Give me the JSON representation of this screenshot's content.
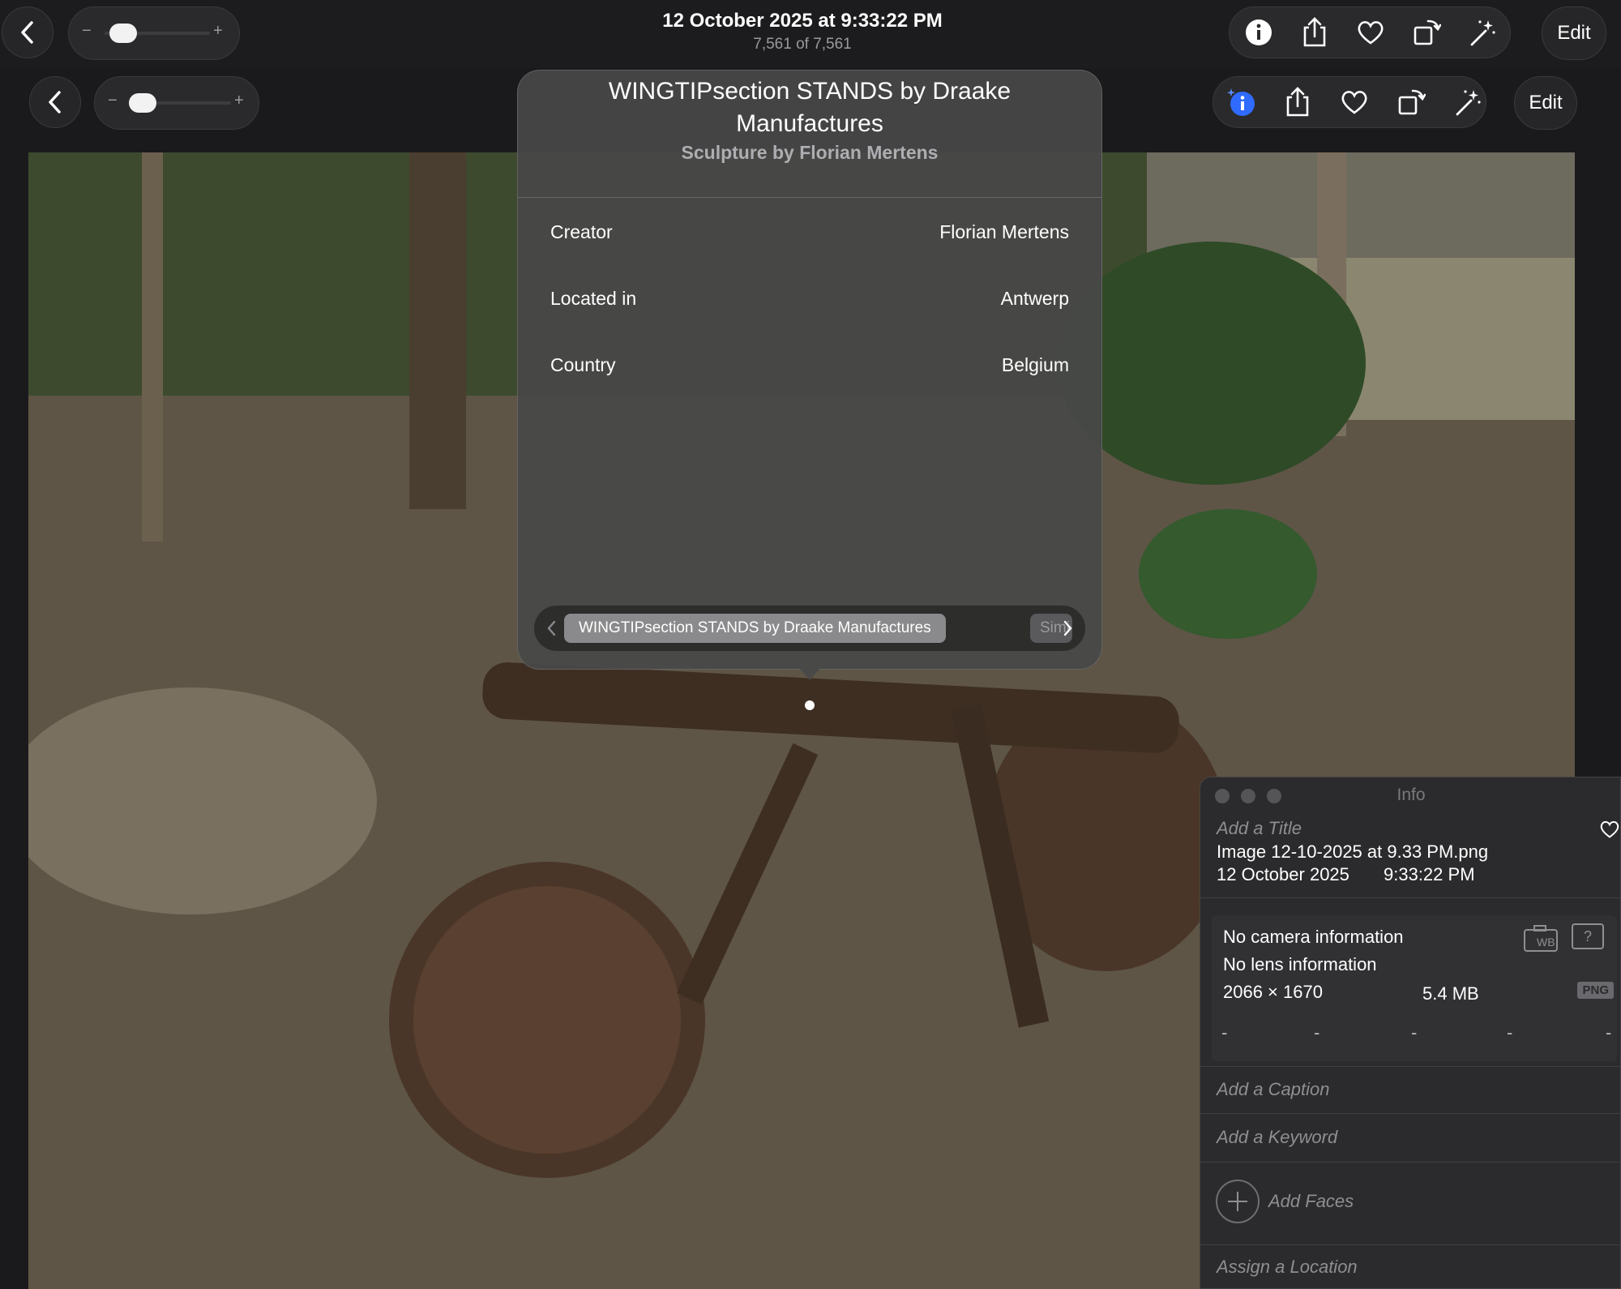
{
  "top_bar": {
    "date_title": "12 October 2025 at 9:33:22 PM",
    "counter": "7,561 of 7,561",
    "edit_label": "Edit",
    "slider_minus": "−",
    "slider_plus": "+",
    "zoom_level": 0.1
  },
  "second_bar": {
    "edit_label": "Edit",
    "slider_minus": "−",
    "slider_plus": "+",
    "zoom_level": 0.1
  },
  "popover": {
    "title": "WINGTIPsection STANDS by Draake Manufactures",
    "subtitle": "Sculpture by Florian Mertens",
    "rows": [
      {
        "label": "Creator",
        "value": "Florian Mertens"
      },
      {
        "label": "Located in",
        "value": "Antwerp"
      },
      {
        "label": "Country",
        "value": "Belgium"
      }
    ],
    "tabs": [
      {
        "label": "WINGTIPsection STANDS by Draake Manufactures",
        "active": true
      },
      {
        "label": "Simi",
        "active": false
      }
    ]
  },
  "info_panel": {
    "header": "Info",
    "title_placeholder": "Add a Title",
    "filename": "Image 12-10-2025 at 9.33 PM.png",
    "date": "12 October 2025",
    "time": "9:33:22 PM",
    "camera": "No camera information",
    "lens": "No lens information",
    "dimensions": "2066 × 1670",
    "filesize": "5.4 MB",
    "format": "PNG",
    "exif_placeholders": [
      "-",
      "-",
      "-",
      "-",
      "-"
    ],
    "caption_placeholder": "Add a Caption",
    "keyword_placeholder": "Add a Keyword",
    "faces_label": "Add Faces",
    "location_placeholder": "Assign a Location",
    "wb_label": "WB",
    "unknown_label": "?"
  },
  "colors": {
    "accent_blue": "#2f6bff",
    "toolbar_bg": "#1c1c1e",
    "panel_bg": "#2b2b2d"
  }
}
